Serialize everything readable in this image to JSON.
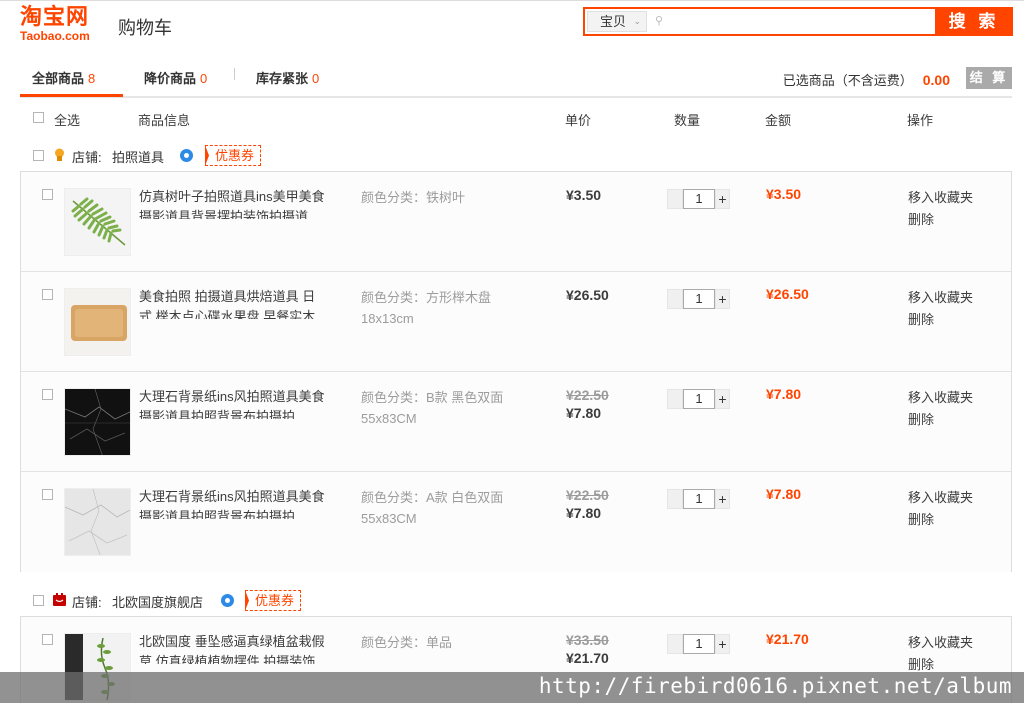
{
  "header": {
    "logo_main": "淘宝网",
    "logo_sub": "Taobao.com",
    "page_title": "购物车",
    "search": {
      "category": "宝贝",
      "placeholder": "",
      "button_label": "搜 索"
    }
  },
  "tabs": [
    {
      "label": "全部商品",
      "count": "8"
    },
    {
      "label": "降价商品",
      "count": "0"
    },
    {
      "label": "库存紧张",
      "count": "0"
    }
  ],
  "summary": {
    "label": "已选商品（不含运费）",
    "total": "0.00",
    "checkout_label": "结 算"
  },
  "columns": {
    "select_all": "全选",
    "info": "商品信息",
    "unit_price": "单价",
    "quantity": "数量",
    "amount": "金额",
    "actions": "操作"
  },
  "shops": [
    {
      "name_prefix": "店铺:",
      "name": "拍照道具",
      "coupon": "优惠券",
      "items": [
        {
          "title": "仿真树叶子拍照道具ins美甲美食摄影道具背景摆拍装饰拍摄道",
          "spec_line1": "颜色分类：铁树叶",
          "spec_line2": "",
          "orig_price": "",
          "price": "¥3.50",
          "qty": "1",
          "amount": "¥3.50",
          "op_fav": "移入收藏夹",
          "op_del": "删除"
        },
        {
          "title": "美食拍照 拍摄道具烘焙道具 日式 榉木点心碟水果盘 早餐实木",
          "spec_line1": "颜色分类：方形榉木盘",
          "spec_line2": "18x13cm",
          "orig_price": "",
          "price": "¥26.50",
          "qty": "1",
          "amount": "¥26.50",
          "op_fav": "移入收藏夹",
          "op_del": "删除"
        },
        {
          "title": "大理石背景纸ins风拍照道具美食摄影道具拍照背景布拍摄拍",
          "spec_line1": "颜色分类：B款 黑色双面",
          "spec_line2": "55x83CM",
          "orig_price": "¥22.50",
          "price": "¥7.80",
          "qty": "1",
          "amount": "¥7.80",
          "op_fav": "移入收藏夹",
          "op_del": "删除"
        },
        {
          "title": "大理石背景纸ins风拍照道具美食摄影道具拍照背景布拍摄拍",
          "spec_line1": "颜色分类：A款 白色双面",
          "spec_line2": "55x83CM",
          "orig_price": "¥22.50",
          "price": "¥7.80",
          "qty": "1",
          "amount": "¥7.80",
          "op_fav": "移入收藏夹",
          "op_del": "删除"
        }
      ]
    },
    {
      "name_prefix": "店铺:",
      "name": "北欧国度旗舰店",
      "coupon": "优惠券",
      "items": [
        {
          "title": "北欧国度 垂坠感逼真绿植盆栽假草 仿真绿植植物摆件 拍摄装饰",
          "spec_line1": "颜色分类：单品",
          "spec_line2": "",
          "orig_price": "¥33.50",
          "price": "¥21.70",
          "qty": "1",
          "amount": "¥21.70",
          "op_fav": "移入收藏夹",
          "op_del": "删除"
        }
      ]
    }
  ],
  "watermark": "http://firebird0616.pixnet.net/album",
  "colors": {
    "brand": "#ff4400",
    "price_red": "#f40",
    "muted": "#9c9c9c"
  }
}
